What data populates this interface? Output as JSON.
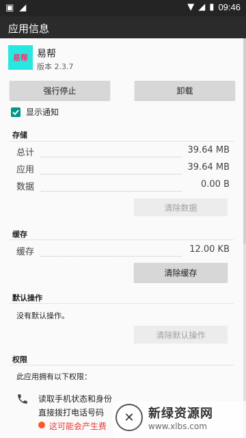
{
  "status_bar": {
    "time": "09:46"
  },
  "app_bar": {
    "title": "应用信息"
  },
  "app": {
    "icon_text": "易帮",
    "name": "易帮",
    "version": "版本 2.3.7"
  },
  "actions": {
    "force_stop": "强行停止",
    "uninstall": "卸载"
  },
  "notifications": {
    "label": "显示通知",
    "checked": true
  },
  "storage": {
    "header": "存储",
    "rows": [
      {
        "label": "总计",
        "value": "39.64 MB"
      },
      {
        "label": "应用",
        "value": "39.64 MB"
      },
      {
        "label": "数据",
        "value": "0.00 B"
      }
    ],
    "clear_data": "清除数据"
  },
  "cache": {
    "header": "缓存",
    "rows": [
      {
        "label": "缓存",
        "value": "12.00 KB"
      }
    ],
    "clear_cache": "清除缓存"
  },
  "defaults": {
    "header": "默认操作",
    "text": "没有默认操作。",
    "clear_defaults": "清除默认操作"
  },
  "permissions": {
    "header": "权限",
    "intro": "此应用拥有以下权限：",
    "items": [
      "读取手机状态和身份",
      "直接拨打电话号码"
    ],
    "warning": "这可能会产生费"
  },
  "watermark": {
    "title": "新绿资源网",
    "url": "www.xlbs.com"
  },
  "colors": {
    "accent": "#009688",
    "app_bar": "#2b2b2b",
    "warning": "#e53935"
  }
}
